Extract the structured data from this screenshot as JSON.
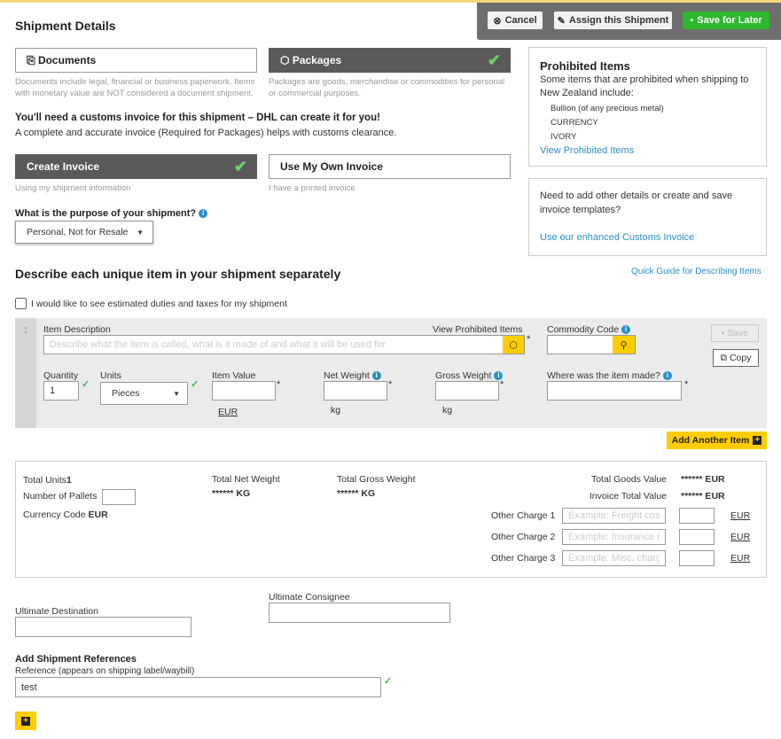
{
  "header": {
    "title": "Shipment Details",
    "cancel": "Cancel",
    "assign": "Assign this Shipment",
    "save_later": "Save for Later"
  },
  "type": {
    "documents": "Documents",
    "packages": "Packages",
    "documents_note": "Documents include legal, financial or business paperwork. Items with monetary value are NOT considered a document shipment.",
    "packages_note": "Packages are goods, merchandise or commodities for personal or commercial purposes.",
    "selected": "Packages"
  },
  "prohibited": {
    "title": "Prohibited Items",
    "text": "Some items that are prohibited when shipping to New Zealand include:",
    "items": [
      "Bullion (of any precious metal)",
      "CURRENCY",
      "IVORY"
    ],
    "link": "View Prohibited Items"
  },
  "templates": {
    "text": "Need to add other details or create and save invoice templates?",
    "link": "Use our enhanced Customs Invoice"
  },
  "invoice": {
    "heading": "You'll need a customs invoice for this shipment – DHL can create it for you!",
    "sub": "A complete and accurate invoice (Required for Packages) helps with customs clearance.",
    "create": "Create Invoice",
    "create_note": "Using my shipment information",
    "own": "Use My Own Invoice",
    "own_note": "I have a printed invoice",
    "selected": "Create Invoice"
  },
  "purpose": {
    "label": "What is the purpose of your shipment?",
    "value": "Personal, Not for Resale"
  },
  "items": {
    "heading": "Describe each unique item in your shipment separately",
    "guide": "Quick Guide for Describing Items",
    "duties_label": "I would like to see estimated duties and taxes for my shipment",
    "duties_checked": false,
    "row": {
      "number": "1",
      "desc_label": "Item Description",
      "desc_placeholder": "Describe what the item is called, what is it made of and what it will be used for.",
      "view_prohibited": "View Prohibited Items",
      "commodity_label": "Commodity Code",
      "save": "Save",
      "copy": "Copy",
      "qty_label": "Quantity",
      "qty": "1",
      "units_label": "Units",
      "units": "Pieces",
      "value_label": "Item Value",
      "value_currency": "EUR",
      "net_label": "Net Weight",
      "net_unit": "kg",
      "gross_label": "Gross Weight",
      "gross_unit": "kg",
      "origin_label": "Where was the item made?"
    },
    "add": "Add Another Item"
  },
  "totals": {
    "units_label": "Total Units",
    "units": "1",
    "pallets_label": "Number of Pallets",
    "currency_label": "Currency Code",
    "currency": "EUR",
    "net_label": "Total Net Weight",
    "net": "****** KG",
    "gross_label": "Total Gross Weight",
    "gross": "****** KG",
    "goods_label": "Total Goods Value",
    "goods": "****** EUR",
    "invoice_label": "Invoice Total Value",
    "invoice": "****** EUR",
    "charges": [
      {
        "label": "Other Charge 1",
        "placeholder": "Example: Freight cost",
        "currency": "EUR"
      },
      {
        "label": "Other Charge 2",
        "placeholder": "Example: Insurance o",
        "currency": "EUR"
      },
      {
        "label": "Other Charge 3",
        "placeholder": "Example: Misc. charg",
        "currency": "EUR"
      }
    ]
  },
  "final": {
    "destination_label": "Ultimate Destination",
    "consignee_label": "Ultimate Consignee",
    "refs_heading": "Add Shipment References",
    "ref_label": "Reference (appears on shipping label/waybill)",
    "ref_value": "test"
  }
}
